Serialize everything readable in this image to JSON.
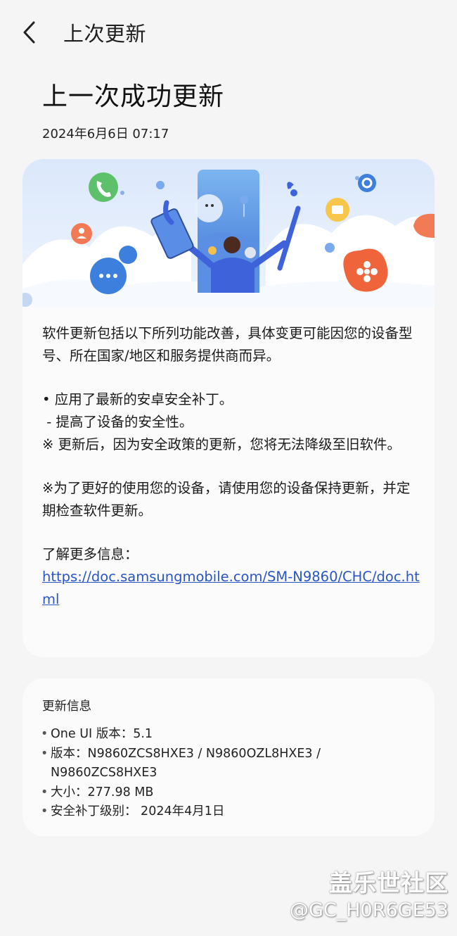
{
  "header": {
    "title": "上次更新"
  },
  "main": {
    "title": "上一次成功更新",
    "date": "2024年6月6日 07:17"
  },
  "notes": {
    "intro": "软件更新包括以下所列功能改善，具体变更可能因您的设备型号、所在国家/地区和服务提供商而异。",
    "bullet1": "• 应用了最新的安卓安全补丁。",
    "bullet1_sub": " - 提高了设备的安全性。",
    "warning": "※ 更新后，因为安全政策的更新，您将无法降级至旧软件。",
    "tip": "※为了更好的使用您的设备，请使用您的设备保持更新，并定期检查软件更新。",
    "more_label": "了解更多信息：",
    "more_link": "https://doc.samsungmobile.com/SM-N9860/CHC/doc.html"
  },
  "update_info": {
    "title": "更新信息",
    "items": [
      "One UI 版本：5.1",
      "版本：N9860ZCS8HXE3 / N9860OZL8HXE3 / N9860ZCS8HXE3",
      "大小：277.98 MB",
      "安全补丁级别： 2024年4月1日"
    ]
  },
  "watermark": {
    "line1": "盖乐世社区",
    "line2": "@GC_H0R6GE53"
  },
  "colors": {
    "background": "#f5f5f5",
    "card": "#fbfbfb",
    "link": "#2955c8",
    "accent_blue": "#3d7fdc",
    "accent_orange": "#f0643c"
  },
  "icons": [
    "back-arrow-icon",
    "phone-icon",
    "chat-icon",
    "flower-icon",
    "gear-icon",
    "person-icon",
    "folder-icon"
  ]
}
